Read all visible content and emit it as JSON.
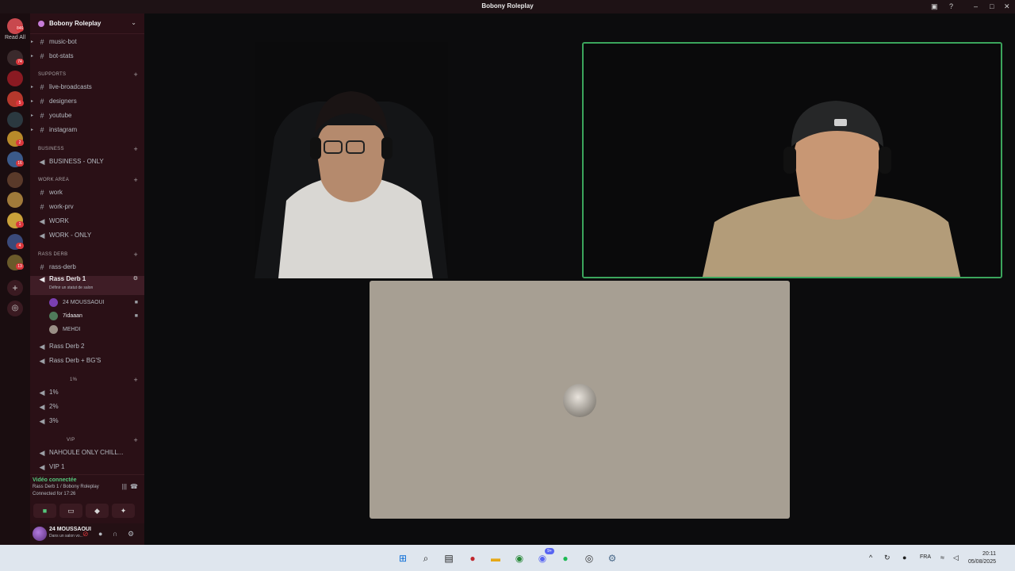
{
  "window": {
    "title": "Bobony Roleplay"
  },
  "rail": {
    "read_all_label": "Read All",
    "top_badge": "846",
    "badges": [
      "74",
      "5",
      "2",
      "16",
      "1",
      "4",
      "13"
    ]
  },
  "guild": {
    "name": "Bobony Roleplay"
  },
  "channels": {
    "music_bot": "music-bot",
    "bot_stats": "bot-stats",
    "cat_supports": "SUPPORTS",
    "live_broadcasts": "live-broadcasts",
    "designers": "designers",
    "youtube": "youtube",
    "instagram": "instagram",
    "cat_business": "BUSINESS",
    "business_only": "BUSINESS - ONLY",
    "cat_work_area": "WORK AREA",
    "work": "work",
    "work_prv": "work-prv",
    "work_voice": "WORK",
    "work_only": "WORK - ONLY",
    "cat_rass_derb": "RASS DERB",
    "rass_derb_text": "rass-derb",
    "rass_derb_1": "Rass Derb 1",
    "rass_derb_1_status": "Définir un statut de salon",
    "rass_derb_2": "Rass Derb 2",
    "rass_derb_bgs": "Rass Derb + BG'S",
    "cat_percent": "1%",
    "pct_1": "1%",
    "pct_2": "2%",
    "pct_3": "3%",
    "cat_vip": "VIP",
    "nahoule": "NAHOULE ONLY CHILL...",
    "vip_1": "VIP 1"
  },
  "voice_members": [
    {
      "name": "24 MOUSSAOUI",
      "camera": true,
      "avatar_color": "#7a3fb0"
    },
    {
      "name": "7idaaan",
      "camera": true,
      "avatar_color": "#4f7a5a"
    },
    {
      "name": "MEHDI",
      "camera": false,
      "avatar_color": "#9a8f86"
    }
  ],
  "voice_panel": {
    "status": "Vidéo connectée",
    "channel": "Rass Derb 1 / Bobony Roleplay",
    "time": "Connected for 17:26"
  },
  "user": {
    "name": "24 MOUSSAOUI",
    "status": "Dans un salon vo..."
  },
  "taskbar": {
    "lang": "FRA",
    "time": "20:11",
    "date": "05/08/2025",
    "discord_badge": "9+"
  },
  "colors": {
    "speaking": "#3ba55c",
    "sidebar": "#2a1016",
    "accent_red": "#da373c"
  }
}
